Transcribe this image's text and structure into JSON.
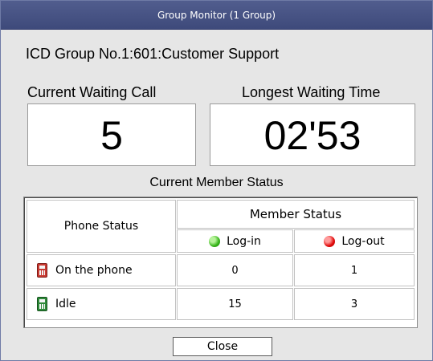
{
  "window": {
    "title": "Group Monitor (1 Group)"
  },
  "group": {
    "title": "ICD Group No.1:601:Customer Support"
  },
  "stats": {
    "waiting_label": "Current Waiting Call",
    "waiting_value": "5",
    "longest_label": "Longest Waiting Time",
    "longest_value": "02'53"
  },
  "member_status": {
    "title": "Current Member Status",
    "phone_status_header": "Phone Status",
    "member_status_header": "Member Status",
    "login_label": "Log-in",
    "logout_label": "Log-out",
    "rows": [
      {
        "label": "On the phone",
        "icon": "phone-red-icon",
        "login": "0",
        "logout": "1"
      },
      {
        "label": "Idle",
        "icon": "phone-green-icon",
        "login": "15",
        "logout": "3"
      }
    ],
    "colors": {
      "login": "#37b51a",
      "logout": "#e20b0b"
    }
  },
  "buttons": {
    "close": "Close"
  }
}
